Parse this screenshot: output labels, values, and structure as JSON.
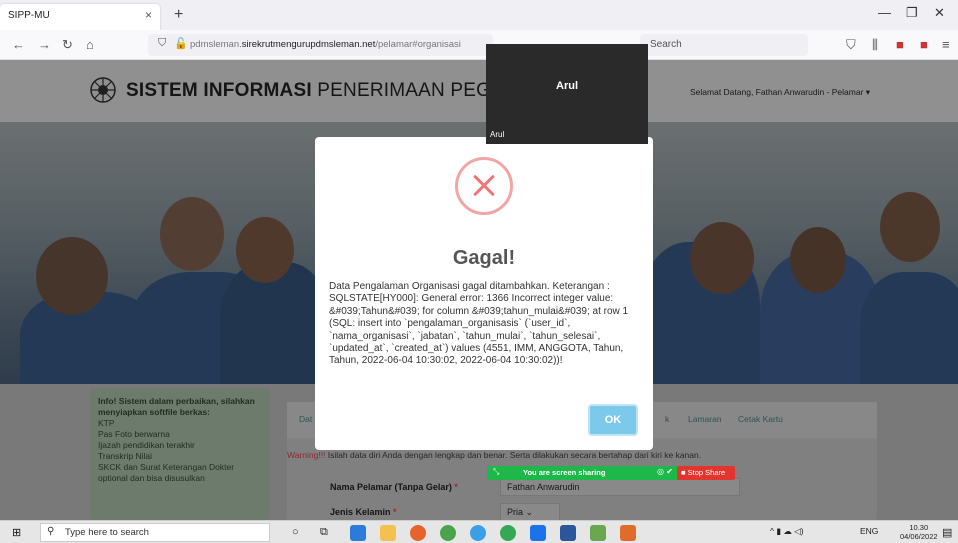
{
  "browser": {
    "tab_title": "SIPP-MU",
    "tab_close": "×",
    "new_tab": "+",
    "url_prefix": "pdmsleman.",
    "url_domain": "sirekrutmengurupdmsleman.net",
    "url_path": "/pelamar#organisasi",
    "search_placeholder": "Search"
  },
  "site": {
    "title_bold": "SISTEM INFORMASI",
    "title_rest": " PENERIMAAN PEGAWAI MUHAM",
    "welcome": "Selamat Datang, Fathan Anwarudin - Pelamar"
  },
  "info": {
    "title": "Info! Sistem dalam perbaikan, silahkan menyiapkan softfile berkas:",
    "items": [
      "KTP",
      "Pas Foto berwarna",
      "Ijazah pendidikan terakhir",
      "Transkrip Nilai",
      "SKCK dan Surat Keterangan Dokter",
      "optional dan bisa disusulkan"
    ]
  },
  "panel": {
    "tab_left": "Dat",
    "tab_k": "k",
    "tab_lamaran": "Lamaran",
    "tab_cetak": "Cetak Kartu",
    "warning_prefix": "Warning!!!",
    "warning_text": " Isilah data diri Anda dengan lengkap dan benar. Serta dilakukan secara bertahap dari kiri ke kanan.",
    "field_nama_label": "Nama Pelamar (Tanpa Gelar)",
    "field_nama_value": "Fathan Anwarudin",
    "field_jk_label": "Jenis Kelamin",
    "field_jk_value": "Pria",
    "required_mark": "*"
  },
  "modal": {
    "title": "Gagal!",
    "message": "Data Pengalaman Organisasi gagal ditambahkan. Keterangan : SQLSTATE[HY000]: General error: 1366 Incorrect integer value: &#039;Tahun&#039; for column &#039;tahun_mulai&#039; at row 1 (SQL: insert into `pengalaman_organisasis` (`user_id`, `nama_organisasi`, `jabatan`, `tahun_mulai`, `tahun_selesai`, `updated_at`, `created_at`) values (4551, IMM, ANGGOTA, Tahun, Tahun, 2022-06-04 10:30:02, 2022-06-04 10:30:02))!",
    "ok_label": "OK"
  },
  "video": {
    "name": "Arul",
    "sub": "Arul"
  },
  "share": {
    "text": "You are screen sharing",
    "stop_label": "Stop Share"
  },
  "taskbar": {
    "search_placeholder": "Type here to search",
    "tray_lang": "ENG",
    "time": "10.30",
    "date": "04/06/2022"
  },
  "colors": {
    "error_red": "#f27474",
    "ok_blue": "#7cc9eb",
    "share_green": "#1eb84a",
    "stop_red": "#e3352d"
  }
}
